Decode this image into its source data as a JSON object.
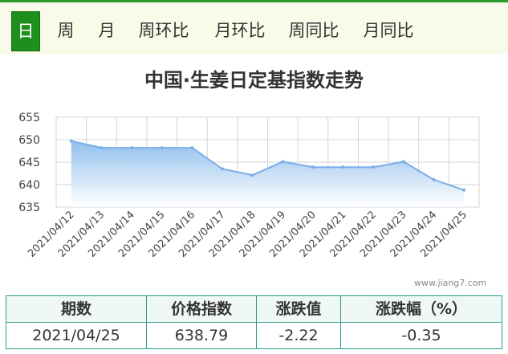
{
  "tabs": [
    {
      "label": "日",
      "active": true
    },
    {
      "label": "周",
      "active": false
    },
    {
      "label": "月",
      "active": false
    },
    {
      "label": "周环比",
      "active": false
    },
    {
      "label": "月环比",
      "active": false
    },
    {
      "label": "周同比",
      "active": false
    },
    {
      "label": "月同比",
      "active": false
    }
  ],
  "chart_data": {
    "type": "area",
    "title": "中国·生姜日定基指数走势",
    "xlabel": "",
    "ylabel": "",
    "x": [
      "2021/04/12",
      "2021/04/13",
      "2021/04/14",
      "2021/04/15",
      "2021/04/16",
      "2021/04/17",
      "2021/04/18",
      "2021/04/19",
      "2021/04/20",
      "2021/04/21",
      "2021/04/22",
      "2021/04/23",
      "2021/04/24",
      "2021/04/25"
    ],
    "series": [
      {
        "values": [
          649.7,
          648.2,
          648.2,
          648.2,
          648.2,
          643.5,
          642.1,
          645.1,
          643.9,
          643.9,
          643.9,
          645.1,
          641.1,
          638.79
        ]
      }
    ],
    "ylim": [
      635,
      655
    ],
    "yticks": [
      635,
      640,
      645,
      650,
      655
    ],
    "grid": true,
    "colors": {
      "line": "#7aaee6",
      "fill_top": "#8bbcec",
      "fill_bottom": "#ffffff",
      "grid": "#d5d5d5"
    }
  },
  "watermark": "www.jiang7.com",
  "table": {
    "headers": [
      "期数",
      "价格指数",
      "涨跌值",
      "涨跌幅（%）"
    ],
    "row": [
      "2021/04/25",
      "638.79",
      "-2.22",
      "-0.35"
    ]
  }
}
